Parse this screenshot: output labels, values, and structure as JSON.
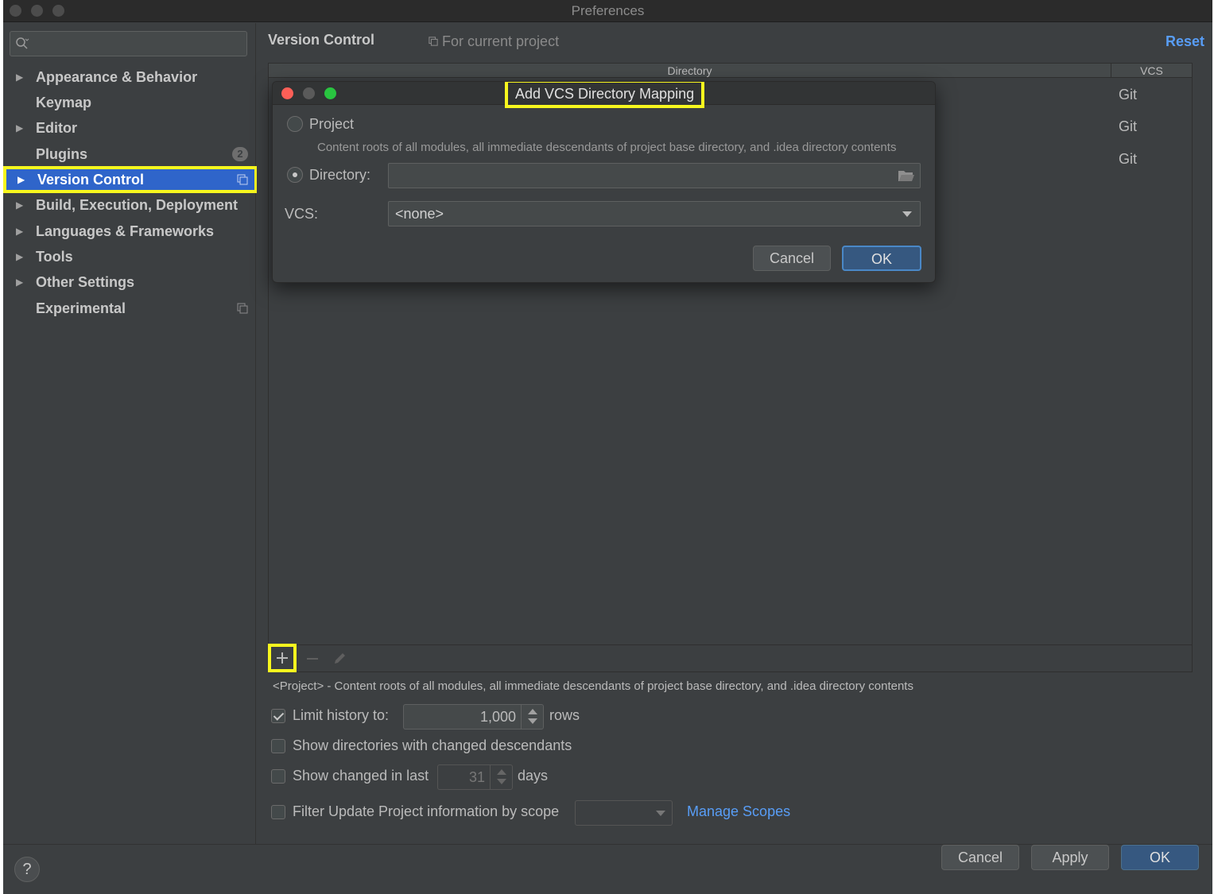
{
  "window": {
    "title": "Preferences"
  },
  "sidebar": {
    "search": {
      "placeholder": "",
      "value": ""
    },
    "items": [
      {
        "label": "Appearance & Behavior",
        "expandable": true
      },
      {
        "label": "Keymap",
        "expandable": false
      },
      {
        "label": "Editor",
        "expandable": true
      },
      {
        "label": "Plugins",
        "expandable": false,
        "badge": "2"
      },
      {
        "label": "Version Control",
        "expandable": true,
        "selected": true
      },
      {
        "label": "Build, Execution, Deployment",
        "expandable": true
      },
      {
        "label": "Languages & Frameworks",
        "expandable": true
      },
      {
        "label": "Tools",
        "expandable": true
      },
      {
        "label": "Other Settings",
        "expandable": true
      },
      {
        "label": "Experimental",
        "expandable": false
      }
    ]
  },
  "main": {
    "title": "Version Control",
    "scope_note": "For current project",
    "reset_label": "Reset",
    "table": {
      "columns": [
        "Directory",
        "VCS"
      ],
      "rows": [
        {
          "directory": "",
          "vcs": "Git"
        },
        {
          "directory": "",
          "vcs": "Git"
        },
        {
          "directory": "",
          "vcs": "Git"
        }
      ]
    },
    "description": "<Project> - Content roots of all modules, all immediate descendants of project base directory, and .idea directory contents",
    "options": {
      "limit_history": {
        "label": "Limit history to:",
        "checked": true,
        "value": "1,000",
        "suffix": "rows"
      },
      "show_dirs": {
        "label": "Show directories with changed descendants",
        "checked": false
      },
      "show_changed": {
        "label": "Show changed in last",
        "checked": false,
        "value": "31",
        "suffix": "days"
      },
      "filter_update": {
        "label": "Filter Update Project information by scope",
        "checked": false,
        "scope_value": "",
        "manage_link": "Manage Scopes"
      }
    }
  },
  "footer": {
    "help_label": "?",
    "cancel_label": "Cancel",
    "apply_label": "Apply",
    "ok_label": "OK"
  },
  "dialog": {
    "title": "Add VCS Directory Mapping",
    "project_option": "Project",
    "project_desc": "Content roots of all modules, all immediate descendants of project base directory, and .idea directory contents",
    "directory_option": "Directory:",
    "directory_value": "",
    "vcs_label": "VCS:",
    "vcs_value": "<none>",
    "cancel_label": "Cancel",
    "ok_label": "OK"
  },
  "colors": {
    "selection": "#2f65ca",
    "highlight": "#f7f71e",
    "link": "#589df6",
    "primary_button": "#365880"
  }
}
